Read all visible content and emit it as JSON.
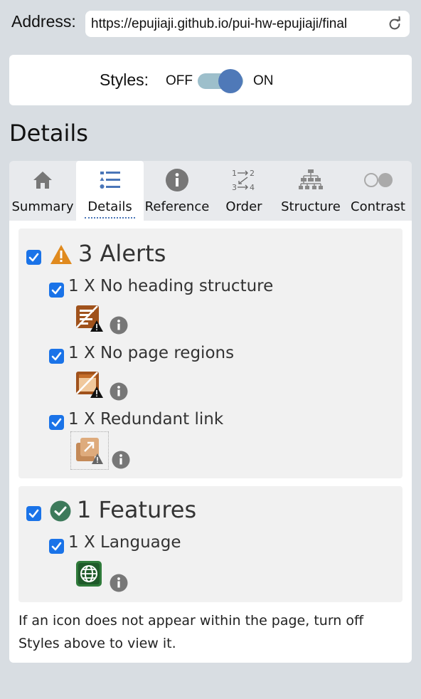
{
  "address": {
    "label": "Address:",
    "url": "https://epujiaji.github.io/pui-hw-epujiaji/final"
  },
  "styles_toggle": {
    "label": "Styles:",
    "off_label": "OFF",
    "on_label": "ON",
    "state": "on"
  },
  "heading": "Details",
  "tabs": [
    {
      "label": "Summary",
      "icon": "home-icon"
    },
    {
      "label": "Details",
      "icon": "list-icon",
      "active": true
    },
    {
      "label": "Reference",
      "icon": "info-icon"
    },
    {
      "label": "Order",
      "icon": "order-icon"
    },
    {
      "label": "Structure",
      "icon": "structure-icon"
    },
    {
      "label": "Contrast",
      "icon": "contrast-icon"
    }
  ],
  "alerts": {
    "title": "3 Alerts",
    "items": [
      {
        "label": "1 X No heading structure",
        "icon": "no-heading-structure-icon"
      },
      {
        "label": "1 X No page regions",
        "icon": "no-page-regions-icon"
      },
      {
        "label": "1 X Redundant link",
        "icon": "redundant-link-icon"
      }
    ]
  },
  "features": {
    "title": "1 Features",
    "items": [
      {
        "label": "1 X Language",
        "icon": "language-icon"
      }
    ]
  },
  "footnote": "If an icon does not appear within the page, turn off Styles above to view it.",
  "colors": {
    "checkbox": "#1a73e8",
    "toggle_knob": "#4f79b8",
    "toggle_track": "#9dbfcb",
    "alert_orange": "#e08a1e",
    "feature_green": "#3d7a5b",
    "background": "#d8dde2"
  }
}
